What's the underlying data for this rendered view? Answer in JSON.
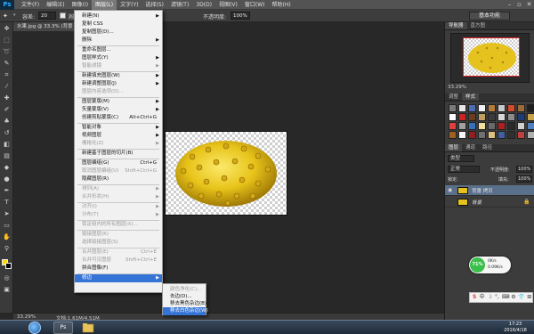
{
  "app": {
    "logo": "Ps",
    "menus": [
      "文件(F)",
      "编辑(E)",
      "图像(I)",
      "图层(L)",
      "文字(Y)",
      "选择(S)",
      "滤镜(T)",
      "3D(D)",
      "视图(V)",
      "窗口(W)",
      "帮助(H)"
    ],
    "active_menu_index": 3,
    "window_controls": [
      "–",
      "▫",
      "✕"
    ]
  },
  "options_bar": {
    "tolerance_label": "容差:",
    "tolerance_value": "20",
    "antialias_label": "消除锯齿",
    "opacity_label": "不透明度:",
    "opacity_value": "100%",
    "workspace_value": "基本功能"
  },
  "document": {
    "tab_title": "水果.jpg @ 33.3% (背景 拷贝, RGB/8#) *",
    "zoom": "33.29%",
    "info": "文档:1.61M/4.51M"
  },
  "layer_menu": {
    "items": [
      {
        "label": "新建(N)",
        "arrow": true
      },
      {
        "label": "复制 CSS"
      },
      {
        "label": "复制图层(D)..."
      },
      {
        "label": "删除",
        "arrow": true
      },
      {
        "sep": true
      },
      {
        "label": "重命名图层..."
      },
      {
        "label": "图层样式(Y)",
        "arrow": true
      },
      {
        "label": "智能滤镜",
        "disabled": true,
        "arrow": true
      },
      {
        "sep": true
      },
      {
        "label": "新建填充图层(W)",
        "arrow": true
      },
      {
        "label": "新建调整图层(J)",
        "arrow": true
      },
      {
        "label": "图层内容选项(O)...",
        "disabled": true
      },
      {
        "sep": true
      },
      {
        "label": "图层蒙版(M)",
        "arrow": true
      },
      {
        "label": "矢量蒙版(V)",
        "arrow": true
      },
      {
        "label": "创建剪贴蒙版(C)",
        "shortcut": "Alt+Ctrl+G"
      },
      {
        "sep": true
      },
      {
        "label": "智能对象",
        "arrow": true
      },
      {
        "label": "视频图层",
        "arrow": true
      },
      {
        "label": "栅格化(Z)",
        "disabled": true,
        "arrow": true
      },
      {
        "sep": true
      },
      {
        "label": "新建基于图层的切片(B)"
      },
      {
        "sep": true
      },
      {
        "label": "图层编组(G)",
        "shortcut": "Ctrl+G"
      },
      {
        "label": "取消图层编组(U)",
        "shortcut": "Shift+Ctrl+G",
        "disabled": true
      },
      {
        "label": "隐藏图层(R)"
      },
      {
        "sep": true
      },
      {
        "label": "排列(A)",
        "disabled": true,
        "arrow": true
      },
      {
        "label": "合并形状(H)",
        "disabled": true,
        "arrow": true
      },
      {
        "sep": true
      },
      {
        "label": "对齐(I)",
        "disabled": true,
        "arrow": true
      },
      {
        "label": "分布(T)",
        "disabled": true,
        "arrow": true
      },
      {
        "sep": true
      },
      {
        "label": "锁定组内的所有图层(X)...",
        "disabled": true
      },
      {
        "sep": true
      },
      {
        "label": "链接图层(K)",
        "disabled": true
      },
      {
        "label": "选择链接图层(S)",
        "disabled": true
      },
      {
        "sep": true
      },
      {
        "label": "合并图层(E)",
        "shortcut": "Ctrl+E",
        "disabled": true
      },
      {
        "label": "合并可见图层",
        "shortcut": "Shift+Ctrl+E",
        "disabled": true
      },
      {
        "label": "拼合图像(F)"
      },
      {
        "sep": true
      },
      {
        "label": "修边",
        "highlight": true,
        "arrow": true
      }
    ]
  },
  "matting_submenu": {
    "items": [
      {
        "label": "颜色净化(C)...",
        "disabled": true
      },
      {
        "label": "去边(D)..."
      },
      {
        "label": "移去黑色杂边(B)"
      },
      {
        "label": "移去白色杂边(W)",
        "highlight": true
      }
    ]
  },
  "panels": {
    "navigator_tabs": [
      "导航器",
      "直方图"
    ],
    "navigator_zoom": "33.29%",
    "styles_tabs": [
      "调整",
      "样式"
    ],
    "style_swatches": [
      "#7a7a7a",
      "#e8e8e8",
      "#4d6db3",
      "#f2f2f2",
      "#b47a3a",
      "#c9c9c9",
      "#d24a2a",
      "#9c6b3a",
      "#202020",
      "#ffffff",
      "#cc2222",
      "#6a3d1e",
      "#c0a060",
      "#3a3a3a",
      "#d8d8d8",
      "#8c8c8c",
      "#1e3c78",
      "#c8a24a",
      "#e04040",
      "#a0a0a0",
      "#3870c0",
      "#f0e0a0",
      "#6a6a6a",
      "#b02020",
      "#2a2a2a",
      "#d0d0d0",
      "#5080c0",
      "#a06020",
      "#f5f5f5",
      "#902020",
      "#707070",
      "#e0c080",
      "#4060a0",
      "#303030",
      "#c04040",
      "#b0b0b0"
    ],
    "layers_tabs": [
      "图层",
      "通道",
      "路径"
    ],
    "kind_label": "类型",
    "blend_mode": "正常",
    "opacity_label": "不透明度:",
    "opacity_value": "100%",
    "lock_label": "锁定:",
    "fill_label": "填充:",
    "fill_value": "100%",
    "layers": [
      {
        "name": "背景 拷贝",
        "selected": true
      },
      {
        "name": "背景",
        "italic": true,
        "locked": true
      }
    ]
  },
  "system": {
    "perf_percent": "71%",
    "perf_up": "0K/s",
    "perf_down": "0.09K/s",
    "ime_icons": [
      "S",
      "中",
      "☽",
      "°,",
      "⌨",
      "⚙",
      "👕",
      "⊞"
    ],
    "time": "17:23",
    "date": "2016/4/18"
  }
}
